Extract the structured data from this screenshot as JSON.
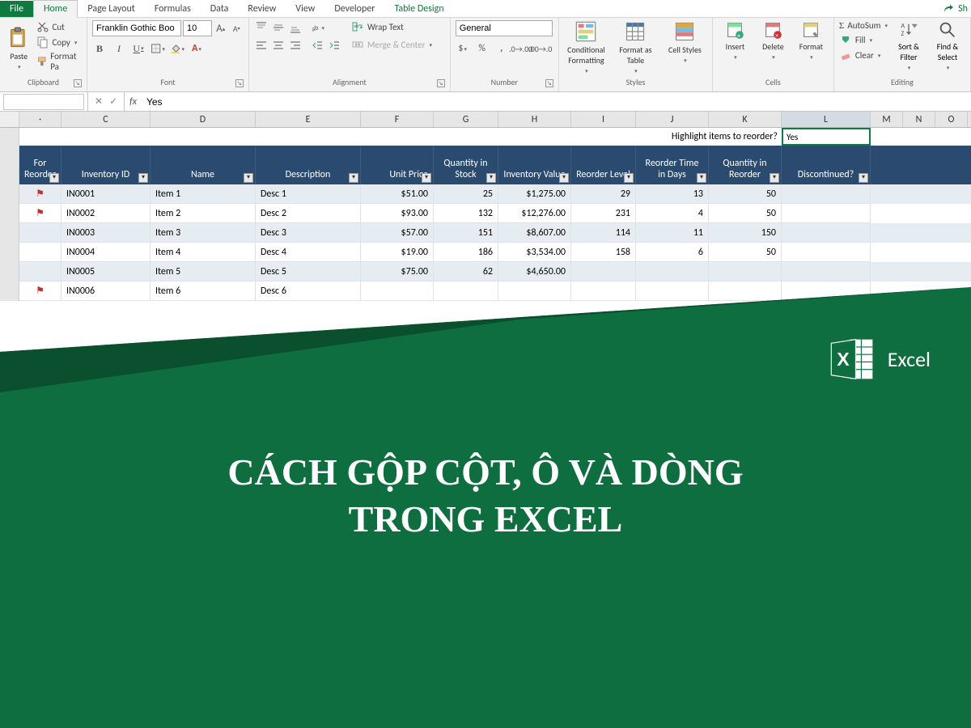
{
  "tabs": {
    "file": "File",
    "home": "Home",
    "page_layout": "Page Layout",
    "formulas": "Formulas",
    "data": "Data",
    "review": "Review",
    "view": "View",
    "developer": "Developer",
    "table_design": "Table Design",
    "share": "Sh"
  },
  "ribbon": {
    "clipboard": {
      "paste": "Paste",
      "cut": "Cut",
      "copy": "Copy",
      "format_painter": "Format Pa",
      "label": "Clipboard"
    },
    "font": {
      "name": "Franklin Gothic Boo",
      "size": "10",
      "label": "Font"
    },
    "alignment": {
      "wrap": "Wrap Text",
      "merge": "Merge & Center",
      "label": "Alignment"
    },
    "number": {
      "format": "General",
      "label": "Number"
    },
    "styles": {
      "cond": "Conditional Formatting",
      "table": "Format as Table",
      "cell": "Cell Styles",
      "label": "Styles"
    },
    "cells": {
      "insert": "Insert",
      "delete": "Delete",
      "format": "Format",
      "label": "Cells"
    },
    "editing": {
      "autosum": "AutoSum",
      "fill": "Fill",
      "clear": "Clear",
      "sort": "Sort & Filter",
      "find": "Find & Select",
      "label": "Editing"
    }
  },
  "formula_bar": {
    "name_box": "",
    "value": "Yes"
  },
  "columns": [
    "",
    "C",
    "D",
    "E",
    "F",
    "G",
    "H",
    "I",
    "J",
    "K",
    "L",
    "M",
    "N",
    "O"
  ],
  "selected_col": "L",
  "highlight": {
    "prompt": "Highlight items to reorder?",
    "value": "Yes"
  },
  "table": {
    "headers": [
      "For Reorder",
      "Inventory ID",
      "Name",
      "Description",
      "Unit Price",
      "Quantity in Stock",
      "Inventory Value",
      "Reorder Level",
      "Reorder Time in Days",
      "Quantity in Reorder",
      "Discontinued?"
    ],
    "rows": [
      {
        "flag": true,
        "id": "IN0001",
        "name": "Item 1",
        "desc": "Desc 1",
        "price": "$51.00",
        "qty": "25",
        "value": "$1,275.00",
        "rlevel": "29",
        "rtime": "13",
        "rqty": "50",
        "disc": ""
      },
      {
        "flag": true,
        "id": "IN0002",
        "name": "Item 2",
        "desc": "Desc 2",
        "price": "$93.00",
        "qty": "132",
        "value": "$12,276.00",
        "rlevel": "231",
        "rtime": "4",
        "rqty": "50",
        "disc": ""
      },
      {
        "flag": false,
        "id": "IN0003",
        "name": "Item 3",
        "desc": "Desc 3",
        "price": "$57.00",
        "qty": "151",
        "value": "$8,607.00",
        "rlevel": "114",
        "rtime": "11",
        "rqty": "150",
        "disc": ""
      },
      {
        "flag": false,
        "id": "IN0004",
        "name": "Item 4",
        "desc": "Desc 4",
        "price": "$19.00",
        "qty": "186",
        "value": "$3,534.00",
        "rlevel": "158",
        "rtime": "6",
        "rqty": "50",
        "disc": ""
      },
      {
        "flag": false,
        "id": "IN0005",
        "name": "Item 5",
        "desc": "Desc 5",
        "price": "$75.00",
        "qty": "62",
        "value": "$4,650.00",
        "rlevel": "",
        "rtime": "",
        "rqty": "",
        "disc": ""
      },
      {
        "flag": true,
        "id": "IN0006",
        "name": "Item 6",
        "desc": "Desc 6",
        "price": "",
        "qty": "",
        "value": "",
        "rlevel": "",
        "rtime": "",
        "rqty": "",
        "disc": ""
      }
    ]
  },
  "overlay": {
    "excel_label": "Excel",
    "title_line1": "CÁCH GỘP CỘT, Ô VÀ DÒNG",
    "title_line2": "TRONG EXCEL"
  },
  "col_widths": {
    "reorder": 52,
    "id": 110,
    "name": 130,
    "desc": 130,
    "price": 90,
    "qty": 80,
    "value": 90,
    "rlevel": 80,
    "rtime": 90,
    "rqty": 90,
    "disc": 110
  }
}
